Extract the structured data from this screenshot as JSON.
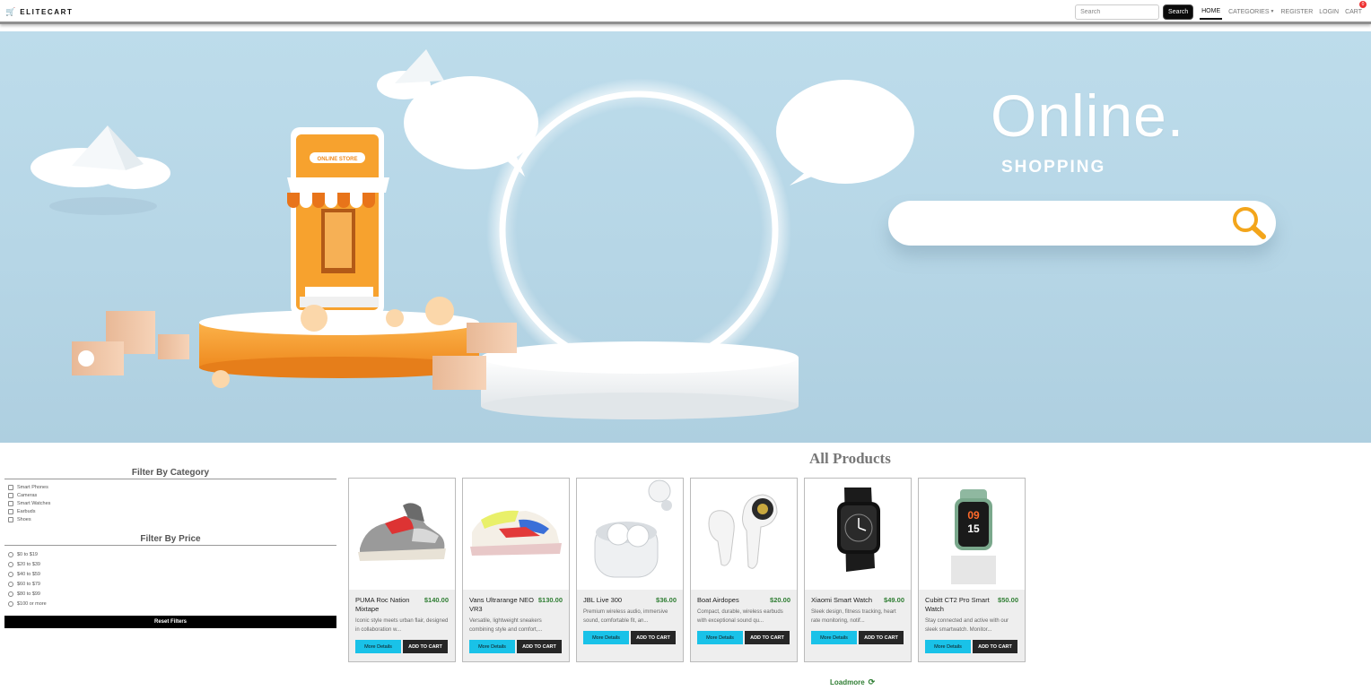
{
  "navbar": {
    "brand": "ELITECART",
    "brand_icon": "cart-icon",
    "search_placeholder": "Search",
    "search_button": "Search",
    "links": {
      "home": "HOME",
      "categories": "CATEGORIES",
      "register": "REGISTER",
      "login": "LOGIN",
      "cart": "CART"
    },
    "cart_count": "0"
  },
  "hero": {
    "title": "Online.",
    "subtitle": "SHOPPING",
    "store_sign": "ONLINE STORE"
  },
  "filters": {
    "category_title": "Filter By Category",
    "categories": [
      "Smart Phones",
      "Cameras",
      "Smart Watches",
      "Earbuds",
      "Shoes"
    ],
    "price_title": "Filter By Price",
    "prices": [
      "$0 to $19",
      "$20 to $39",
      "$40 to $59",
      "$60 to $79",
      "$80 to $99",
      "$100 or more"
    ],
    "reset_label": "Reset Filters"
  },
  "products": {
    "title": "All Products",
    "details_label": "More Details",
    "cart_label": "ADD TO CART",
    "items": [
      {
        "name": "PUMA Roc Nation Mixtape",
        "price": "$140.00",
        "desc": "Iconic style meets urban flair, designed in collaboration w..."
      },
      {
        "name": "Vans Ultrarange NEO VR3",
        "price": "$130.00",
        "desc": "Versatile, lightweight sneakers combining style and comfort,..."
      },
      {
        "name": "JBL Live 300",
        "price": "$36.00",
        "desc": "Premium wireless audio, immersive sound, comfortable fit, an..."
      },
      {
        "name": "Boat Airdopes",
        "price": "$20.00",
        "desc": "Compact, durable, wireless earbuds with exceptional sound qu..."
      },
      {
        "name": "Xiaomi Smart Watch",
        "price": "$49.00",
        "desc": "Sleek design, fitness tracking, heart rate monitoring, notif..."
      },
      {
        "name": "Cubitt CT2 Pro Smart Watch",
        "price": "$50.00",
        "desc": "Stay connected and active with our sleek smartwatch. Monitor..."
      }
    ],
    "loadmore": "Loadmore",
    "watch_screen": {
      "hour": "09",
      "minute": "15"
    }
  },
  "colors": {
    "accent_cyan": "#19c2e8",
    "price_green": "#2e7d32",
    "hero_bg": "#bddceb",
    "store_orange": "#f7a22e"
  }
}
